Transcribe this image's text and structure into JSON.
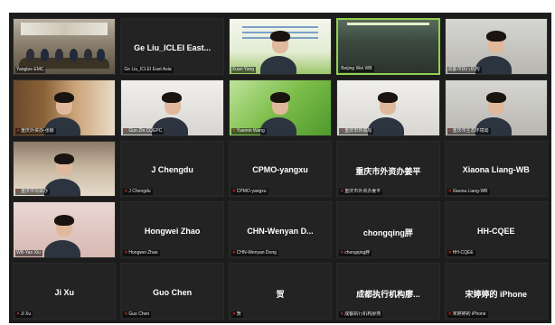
{
  "participants": [
    {
      "tile_name": "",
      "label": "Yangtze EMC",
      "kind": "video",
      "scene": "room",
      "muted": false
    },
    {
      "tile_name": "Ge Liu_ICLEI East...",
      "label": "Ge Liu_ICLEI East Asia",
      "kind": "name",
      "muted": false
    },
    {
      "tile_name": "",
      "label": "Xuan Yang",
      "kind": "video",
      "scene": "slide",
      "muted": false
    },
    {
      "tile_name": "",
      "label": "Beijing Wei WB",
      "kind": "video",
      "scene": "office",
      "muted": false,
      "active": true
    },
    {
      "tile_name": "",
      "label": "成都市执行机构",
      "kind": "video",
      "scene": "gray-room",
      "muted": false
    },
    {
      "tile_name": "",
      "label": "重庆外资办-张颖",
      "kind": "video",
      "scene": "shelf",
      "muted": true
    },
    {
      "tile_name": "",
      "label": "Guo Zhi CQEPC",
      "kind": "video",
      "scene": "white-room",
      "muted": true
    },
    {
      "tile_name": "",
      "label": "Yuemin Wang",
      "kind": "video",
      "scene": "green-bg",
      "muted": true
    },
    {
      "tile_name": "",
      "label": "重庆市环境局",
      "kind": "video",
      "scene": "white-room",
      "muted": true
    },
    {
      "tile_name": "",
      "label": "重庆市生态环境局",
      "kind": "video",
      "scene": "gray-room",
      "muted": true
    },
    {
      "tile_name": "",
      "label": "重庆市项目办",
      "kind": "video",
      "scene": "warm-room",
      "muted": true
    },
    {
      "tile_name": "J Chengdu",
      "label": "J Chengdu",
      "kind": "name",
      "muted": true
    },
    {
      "tile_name": "CPMO-yangxu",
      "label": "CPMO-yangxu",
      "kind": "name",
      "muted": true
    },
    {
      "tile_name": "重庆市外资办姜平",
      "label": "重庆市外资办姜平",
      "kind": "name",
      "muted": true
    },
    {
      "tile_name": "Xiaona Liang-WB",
      "label": "Xiaona Liang-WB",
      "kind": "name",
      "muted": true
    },
    {
      "tile_name": "",
      "label": "WB-Yao Xiu",
      "kind": "video",
      "scene": "pink-room",
      "muted": false
    },
    {
      "tile_name": "Hongwei Zhao",
      "label": "Hongwei Zhao",
      "kind": "name",
      "muted": true
    },
    {
      "tile_name": "CHN-Wenyan D...",
      "label": "CHN-Wenyan Dong",
      "kind": "name",
      "muted": true
    },
    {
      "tile_name": "chongqing胖",
      "label": "chongqing胖",
      "kind": "name",
      "muted": true
    },
    {
      "tile_name": "HH-CQEE",
      "label": "HH-CQEE",
      "kind": "name",
      "muted": true
    },
    {
      "tile_name": "Ji Xu",
      "label": "Ji Xu",
      "kind": "name",
      "muted": true
    },
    {
      "tile_name": "Guo Chen",
      "label": "Guo Chen",
      "kind": "name",
      "muted": true
    },
    {
      "tile_name": "贺",
      "label": "贺",
      "kind": "name",
      "muted": true
    },
    {
      "tile_name": "成都执行机构廖...",
      "label": "成都执行机构廖燕",
      "kind": "name",
      "muted": true
    },
    {
      "tile_name": "宋婷婷的 iPhone",
      "label": "宋婷婷的 iPhone",
      "kind": "name",
      "muted": true
    }
  ],
  "icons": {
    "mic_muted": "mic-muted-icon"
  },
  "colors": {
    "background": "#1c1c1c",
    "tile": "#232323",
    "active_border": "#8fd14f",
    "muted_icon": "#ff3b30"
  }
}
